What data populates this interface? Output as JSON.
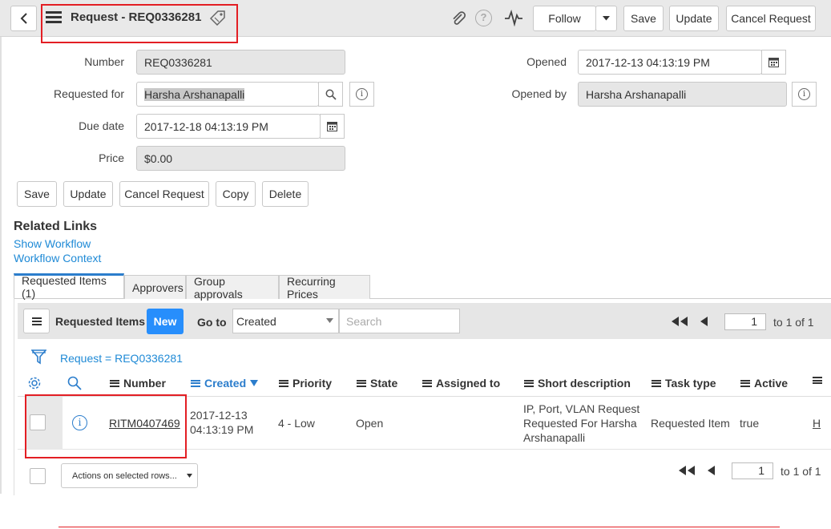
{
  "header": {
    "title": "Request - REQ0336281",
    "follow_label": "Follow",
    "save_label": "Save",
    "update_label": "Update",
    "cancel_request_label": "Cancel Request"
  },
  "form": {
    "number_label": "Number",
    "number_value": "REQ0336281",
    "requested_for_label": "Requested for",
    "requested_for_value": "Harsha Arshanapalli",
    "due_date_label": "Due date",
    "due_date_value": "2017-12-18 04:13:19 PM",
    "price_label": "Price",
    "price_value": "$0.00",
    "opened_label": "Opened",
    "opened_value": "2017-12-13 04:13:19 PM",
    "opened_by_label": "Opened by",
    "opened_by_value": "Harsha Arshanapalli"
  },
  "form_buttons": {
    "save": "Save",
    "update": "Update",
    "cancel_request": "Cancel Request",
    "copy": "Copy",
    "delete": "Delete"
  },
  "related_links": {
    "heading": "Related Links",
    "show_workflow": "Show Workflow",
    "workflow_context": "Workflow Context"
  },
  "tabs": [
    {
      "label": "Requested Items (1)"
    },
    {
      "label": "Approvers"
    },
    {
      "label": "Group approvals"
    },
    {
      "label": "Recurring Prices"
    }
  ],
  "list": {
    "title": "Requested Items",
    "new_label": "New",
    "goto_label": "Go to",
    "goto_selected": "Created",
    "search_placeholder": "Search",
    "page_value": "1",
    "page_total": "to 1 of 1",
    "filter_text": "Request = REQ0336281",
    "columns": [
      "Number",
      "Created",
      "Priority",
      "State",
      "Assigned to",
      "Short description",
      "Task type",
      "Active"
    ],
    "row": {
      "number": "RITM0407469",
      "created_line1": "2017-12-13",
      "created_line2": "04:13:19 PM",
      "priority": "4 - Low",
      "state": "Open",
      "assigned_to": "",
      "short_desc_line1": "IP, Port, VLAN Request",
      "short_desc_line2": "Requested For Harsha",
      "short_desc_line3": "Arshanapalli",
      "task_type": "Requested Item",
      "active": "true",
      "overflow": "H"
    },
    "actions_select": "Actions on selected rows...",
    "bottom_page_value": "1",
    "bottom_page_total": "to 1 of 1"
  },
  "colors": {
    "accent": "#2b7dcc",
    "new_button": "#278efc",
    "link": "#1f8ad6",
    "highlight_box": "#e31e24"
  },
  "icons": [
    "back-icon",
    "menu-icon",
    "tag-icon",
    "paperclip-icon",
    "help-icon",
    "activity-icon",
    "caret-down-icon",
    "search-icon",
    "info-icon",
    "calendar-icon",
    "filter-icon",
    "gear-icon",
    "first-page-icon",
    "prev-page-icon",
    "sort-desc-icon"
  ]
}
